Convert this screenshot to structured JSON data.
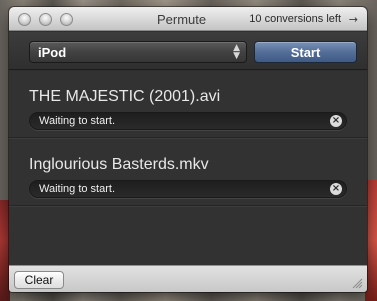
{
  "window": {
    "title": "Permute",
    "conversions_left": "10 conversions left",
    "arrow_icon": "→"
  },
  "toolbar": {
    "preset_value": "iPod",
    "preset_icon": "⇕",
    "start_label": "Start"
  },
  "items": [
    {
      "name": "THE MAJESTIC (2001).avi",
      "status": "Waiting to start.",
      "cancel_icon": "×"
    },
    {
      "name": "Inglourious Basterds.mkv",
      "status": "Waiting to start.",
      "cancel_icon": "×"
    }
  ],
  "footer": {
    "clear_label": "Clear"
  },
  "colors": {
    "start_button": "#546e98",
    "list_background": "#323232",
    "text_primary": "#e8e8e8"
  }
}
